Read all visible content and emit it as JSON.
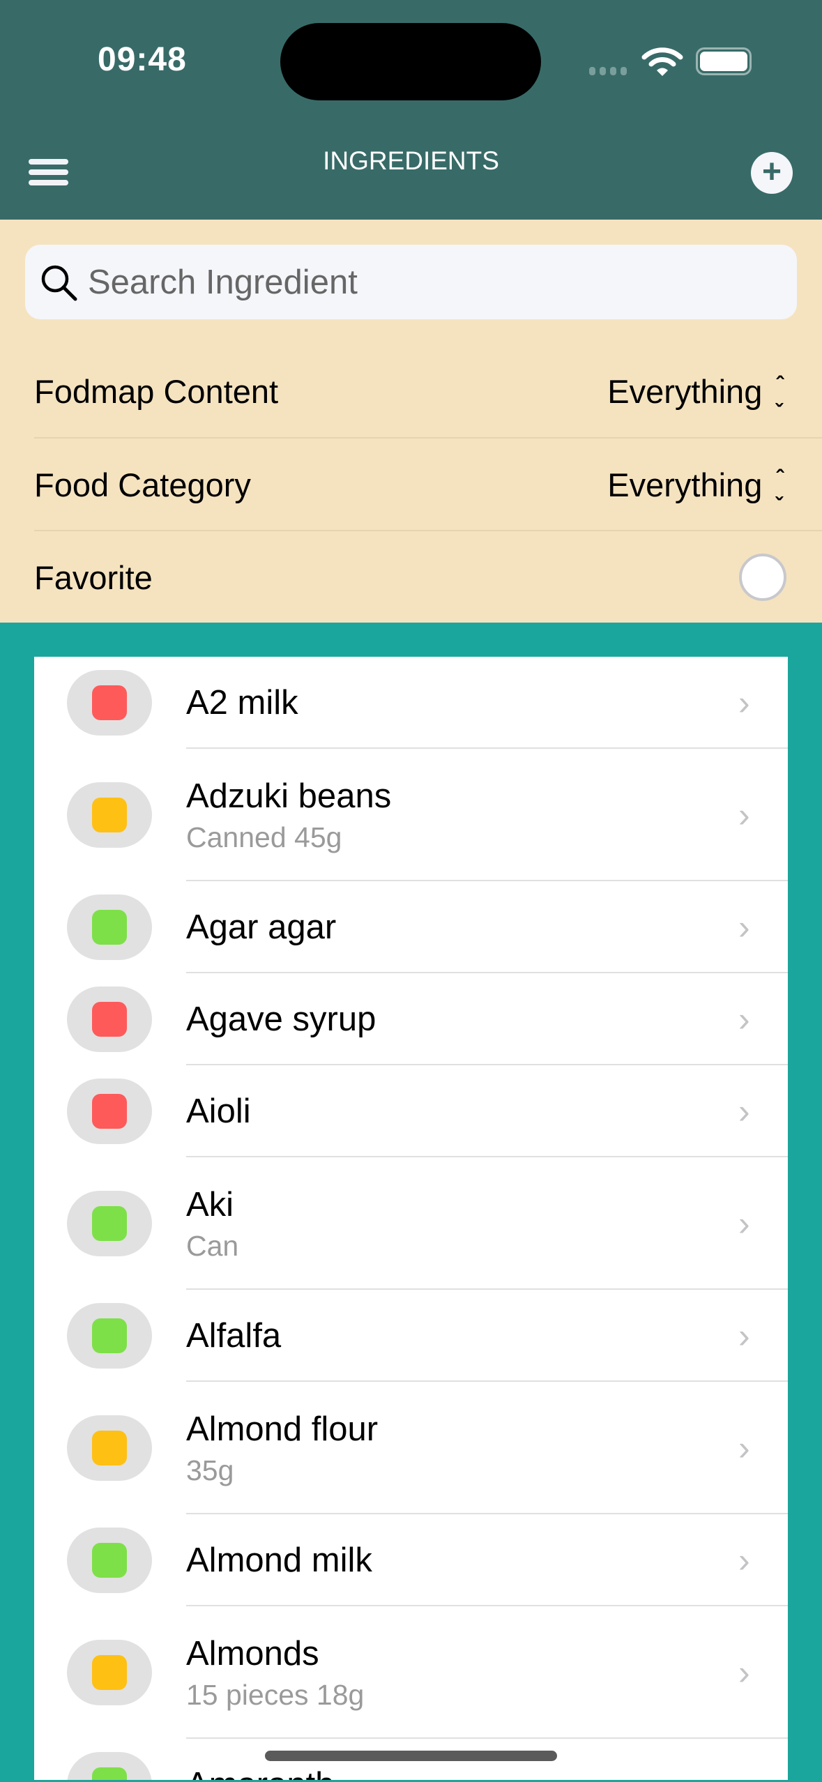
{
  "status": {
    "time": "09:48"
  },
  "header": {
    "title": "INGREDIENTS",
    "menu_icon": "hamburger-icon",
    "add_icon": "plus-icon"
  },
  "search": {
    "placeholder": "Search Ingredient",
    "value": ""
  },
  "filters": [
    {
      "label": "Fodmap Content",
      "value": "Everything"
    },
    {
      "label": "Food Category",
      "value": "Everything"
    },
    {
      "label": "Favorite",
      "toggle": false
    }
  ],
  "colors": {
    "high": "#FF5A5A",
    "medium": "#FFC014",
    "low": "#7EE048",
    "header": "#386B68",
    "filters": "#F5E3C0",
    "background": "#1AA69C"
  },
  "items": [
    {
      "name": "A2 milk",
      "sub": "",
      "level": "high"
    },
    {
      "name": "Adzuki beans",
      "sub": "Canned 45g",
      "level": "medium"
    },
    {
      "name": "Agar agar",
      "sub": "",
      "level": "low"
    },
    {
      "name": "Agave syrup",
      "sub": "",
      "level": "high"
    },
    {
      "name": "Aioli",
      "sub": "",
      "level": "high"
    },
    {
      "name": "Aki",
      "sub": "Can",
      "level": "low"
    },
    {
      "name": "Alfalfa",
      "sub": "",
      "level": "low"
    },
    {
      "name": "Almond flour",
      "sub": "35g",
      "level": "medium"
    },
    {
      "name": "Almond milk",
      "sub": "",
      "level": "low"
    },
    {
      "name": "Almonds",
      "sub": "15 pieces 18g",
      "level": "medium"
    },
    {
      "name": "Amaranth",
      "sub": "",
      "level": "low"
    }
  ]
}
